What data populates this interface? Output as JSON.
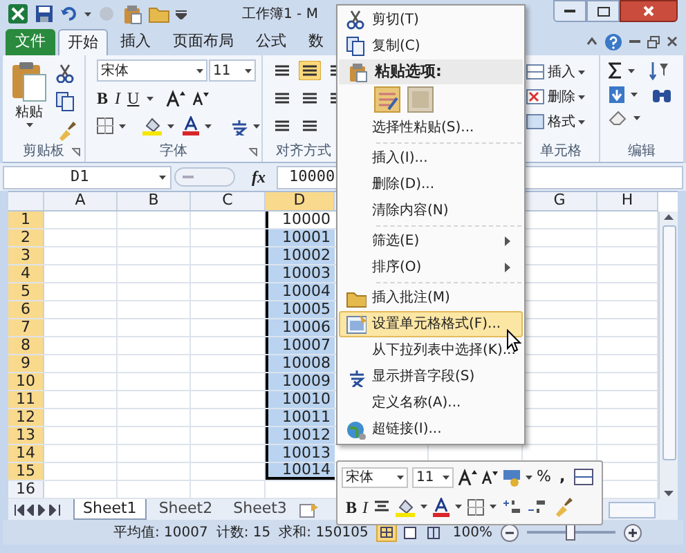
{
  "window": {
    "title": "工作簿1 - M"
  },
  "ribbon_tabs": [
    {
      "label": "文件",
      "kind": "backstage",
      "selected": false
    },
    {
      "label": "开始",
      "kind": "tab",
      "selected": true
    },
    {
      "label": "插入",
      "kind": "tab",
      "selected": false
    },
    {
      "label": "页面布局",
      "kind": "tab",
      "selected": false
    },
    {
      "label": "公式",
      "kind": "tab",
      "selected": false
    },
    {
      "label": "数",
      "kind": "tab",
      "selected": false
    }
  ],
  "clipboard_group": {
    "paste": "粘贴",
    "label": "剪贴板"
  },
  "font_group": {
    "font": "宋体",
    "size": "11",
    "bold": "B",
    "italic": "I",
    "underline": "U",
    "label": "字体"
  },
  "alignment_group": {
    "label": "对齐方式"
  },
  "cells_group": {
    "buttons": [
      "插入",
      "删除",
      "格式"
    ],
    "label": "单元格"
  },
  "editing_group": {
    "label": "编辑"
  },
  "formula_bar": {
    "name_box": "D1",
    "fx": "fx",
    "value": "10000"
  },
  "sheet": {
    "columns": [
      {
        "kind": "label",
        "label": "A"
      },
      {
        "kind": "label",
        "label": "B"
      },
      {
        "kind": "label",
        "label": "C"
      },
      {
        "kind": "label",
        "label": "D"
      },
      {
        "kind": "covered"
      },
      {
        "kind": "covered"
      },
      {
        "kind": "label",
        "label": "G"
      },
      {
        "kind": "label",
        "label": "H"
      }
    ],
    "rows": [
      {
        "header": "1",
        "d": "10000",
        "selected": true,
        "active": true
      },
      {
        "header": "2",
        "d": "10001",
        "selected": true,
        "active": false
      },
      {
        "header": "3",
        "d": "10002",
        "selected": true,
        "active": false
      },
      {
        "header": "4",
        "d": "10003",
        "selected": true,
        "active": false
      },
      {
        "header": "5",
        "d": "10004",
        "selected": true,
        "active": false
      },
      {
        "header": "6",
        "d": "10005",
        "selected": true,
        "active": false
      },
      {
        "header": "7",
        "d": "10006",
        "selected": true,
        "active": false
      },
      {
        "header": "8",
        "d": "10007",
        "selected": true,
        "active": false
      },
      {
        "header": "9",
        "d": "10008",
        "selected": true,
        "active": false
      },
      {
        "header": "10",
        "d": "10009",
        "selected": true,
        "active": false
      },
      {
        "header": "11",
        "d": "10010",
        "selected": true,
        "active": false
      },
      {
        "header": "12",
        "d": "10011",
        "selected": true,
        "active": false
      },
      {
        "header": "13",
        "d": "10012",
        "selected": true,
        "active": false
      },
      {
        "header": "14",
        "d": "10013",
        "selected": true,
        "active": false
      },
      {
        "header": "15",
        "d": "10014",
        "selected": true,
        "active": false
      },
      {
        "header": "16",
        "selected": false,
        "active": false
      }
    ]
  },
  "sheet_tabs": [
    {
      "label": "Sheet1",
      "selected": true
    },
    {
      "label": "Sheet2",
      "selected": false
    },
    {
      "label": "Sheet3",
      "selected": false
    }
  ],
  "status_bar": {
    "average": "平均值: 10007",
    "count": "计数: 15",
    "sum": "求和: 150105",
    "zoom": "100%",
    "zoom_slider": {
      "level": 0.5
    }
  },
  "context_menu": {
    "items": [
      {
        "kind": "command",
        "label": "剪切(T)",
        "selected": false
      },
      {
        "kind": "command",
        "label": "复制(C)",
        "selected": false
      },
      {
        "kind": "header",
        "label": "粘贴选项:"
      },
      {
        "kind": "paste_options"
      },
      {
        "kind": "command",
        "label": "选择性粘贴(S)...",
        "selected": false
      },
      {
        "kind": "separator"
      },
      {
        "kind": "command",
        "label": "插入(I)...",
        "selected": false
      },
      {
        "kind": "command",
        "label": "删除(D)...",
        "selected": false
      },
      {
        "kind": "command",
        "label": "清除内容(N)",
        "selected": false
      },
      {
        "kind": "separator"
      },
      {
        "kind": "submenu",
        "label": "筛选(E)",
        "selected": false
      },
      {
        "kind": "submenu",
        "label": "排序(O)",
        "selected": false
      },
      {
        "kind": "separator"
      },
      {
        "kind": "command",
        "label": "插入批注(M)",
        "selected": false
      },
      {
        "kind": "command",
        "label": "设置单元格格式(F)...",
        "selected": true
      },
      {
        "kind": "command",
        "label": "从下拉列表中选择(K)...",
        "selected": false
      },
      {
        "kind": "command",
        "label": "显示拼音字段(S)",
        "selected": false
      },
      {
        "kind": "command",
        "label": "定义名称(A)...",
        "selected": false
      },
      {
        "kind": "command",
        "label": "超链接(I)...",
        "selected": false
      }
    ]
  },
  "mini_toolbar": {
    "font": "宋体",
    "size": "11",
    "percent": "%",
    "comma": ",",
    "bold": "B",
    "italic": "I"
  }
}
